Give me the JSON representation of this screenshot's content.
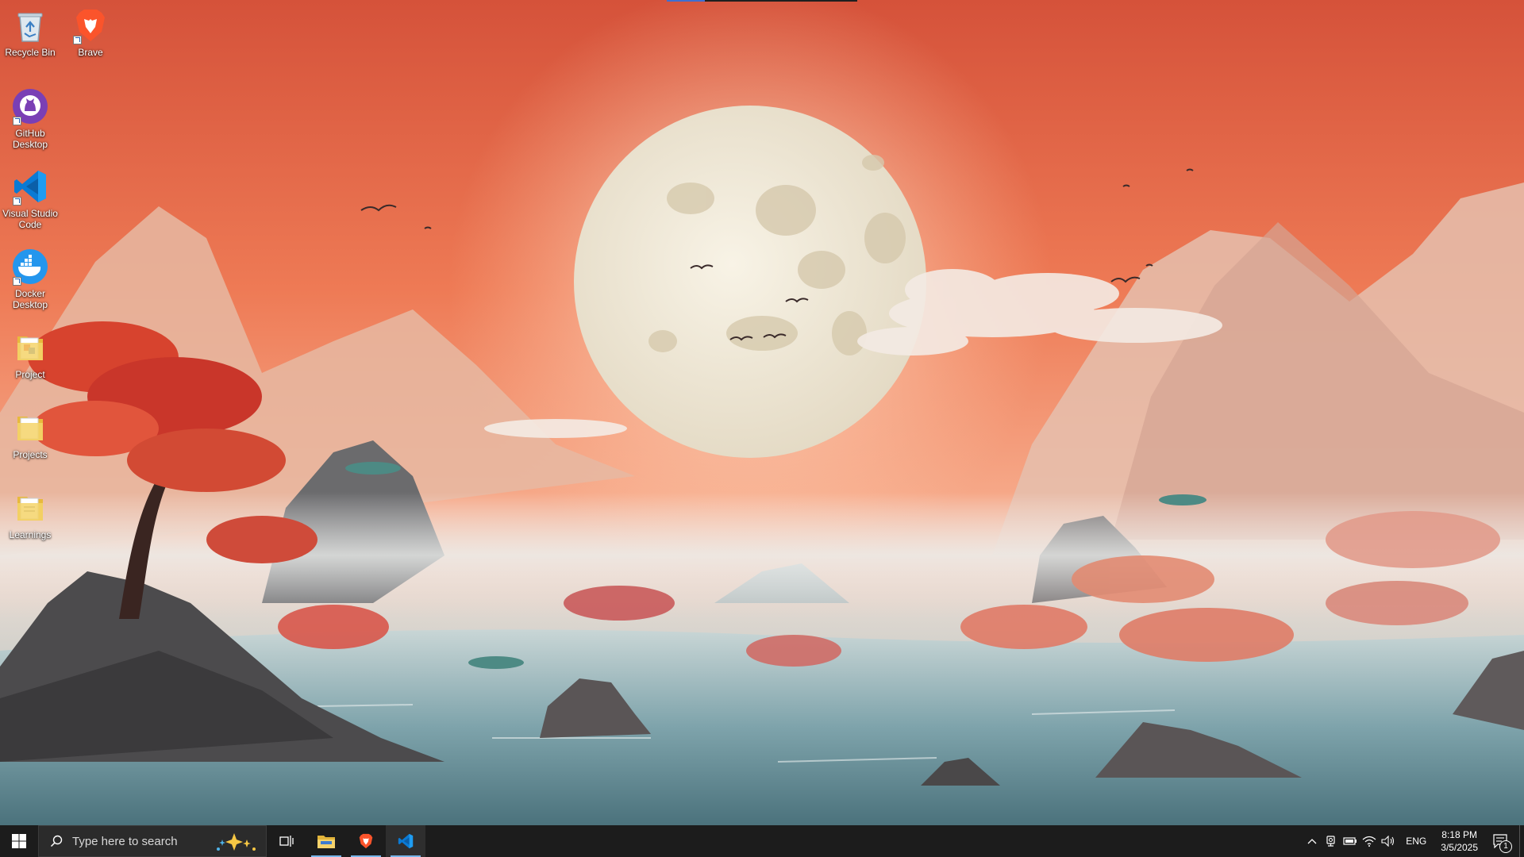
{
  "desktop": {
    "icons": [
      {
        "label": "Recycle Bin",
        "icon": "recycle-bin-icon",
        "shortcut": false
      },
      {
        "label": "Brave",
        "icon": "brave-icon",
        "shortcut": true
      },
      {
        "label": "GitHub Desktop",
        "icon": "github-desktop-icon",
        "shortcut": true
      },
      {
        "label": "Visual Studio Code",
        "icon": "vscode-icon",
        "shortcut": true
      },
      {
        "label": "Docker Desktop",
        "icon": "docker-icon",
        "shortcut": true
      },
      {
        "label": "Project",
        "icon": "folder-icon",
        "shortcut": false
      },
      {
        "label": "Projects",
        "icon": "folder-icon",
        "shortcut": false
      },
      {
        "label": "Learnings",
        "icon": "folder-icon",
        "shortcut": false
      }
    ]
  },
  "taskbar": {
    "search_placeholder": "Type here to search",
    "pinned": [
      {
        "name": "Task View",
        "icon": "task-view-icon",
        "active": false,
        "running": false
      },
      {
        "name": "File Explorer",
        "icon": "file-explorer-icon",
        "active": false,
        "running": true
      },
      {
        "name": "Brave",
        "icon": "brave-icon",
        "active": false,
        "running": true
      },
      {
        "name": "Visual Studio Code",
        "icon": "vscode-icon",
        "active": true,
        "running": true
      }
    ],
    "tray": {
      "language": "ENG",
      "time": "8:18 PM",
      "date": "3/5/2025",
      "notification_count": "1"
    }
  },
  "colors": {
    "taskbar_bg": "#1c1c1c",
    "running_indicator": "#77b6ea",
    "sky_top": "#d9563a",
    "sky_mid": "#f08a62",
    "moon": "#f1ebdc"
  }
}
